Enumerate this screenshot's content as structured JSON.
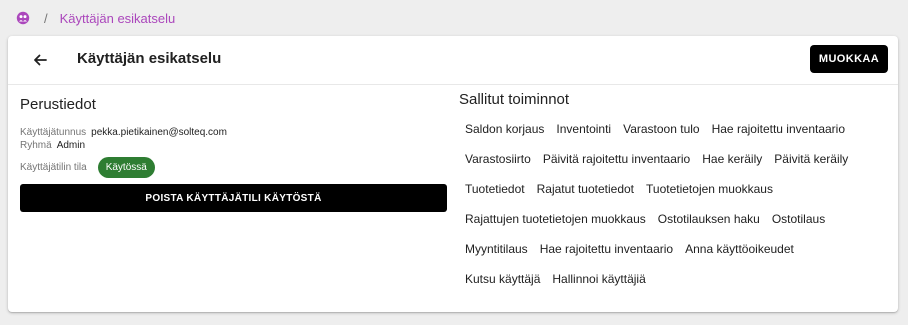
{
  "breadcrumb": {
    "separator": "/",
    "current": "Käyttäjän esikatselu"
  },
  "header": {
    "title": "Käyttäjän esikatselu",
    "edit_label": "MUOKKAA"
  },
  "basic_info": {
    "title": "Perustiedot",
    "username_label": "Käyttäjätunnus",
    "username_value": "pekka.pietikainen@solteq.com",
    "group_label": "Ryhmä",
    "group_value": "Admin",
    "status_label": "Käyttäjätilin tila",
    "status_value": "Käytössä",
    "remove_label": "POISTA KÄYTTÄJÄTILI KÄYTÖSTÄ"
  },
  "permissions": {
    "title": "Sallitut toiminnot",
    "rows": [
      [
        "Saldon korjaus",
        "Inventointi",
        "Varastoon tulo",
        "Hae rajoitettu inventaario"
      ],
      [
        "Varastosiirto",
        "Päivitä rajoitettu inventaario",
        "Hae keräily",
        "Päivitä keräily"
      ],
      [
        "Tuotetiedot",
        "Rajatut tuotetiedot",
        "Tuotetietojen muokkaus"
      ],
      [
        "Rajattujen tuotetietojen muokkaus",
        "Ostotilauksen haku",
        "Ostotilaus"
      ],
      [
        "Myyntitilaus",
        "Hae rajoitettu inventaario",
        "Anna käyttöoikeudet"
      ],
      [
        "Kutsu käyttäjä",
        "Hallinnoi käyttäjiä"
      ]
    ]
  },
  "colors": {
    "accent": "#ab47bc",
    "status_green": "#2e7d32",
    "button_black": "#000000"
  },
  "icons": {
    "home": "user-group-icon",
    "back": "arrow-left-icon"
  }
}
